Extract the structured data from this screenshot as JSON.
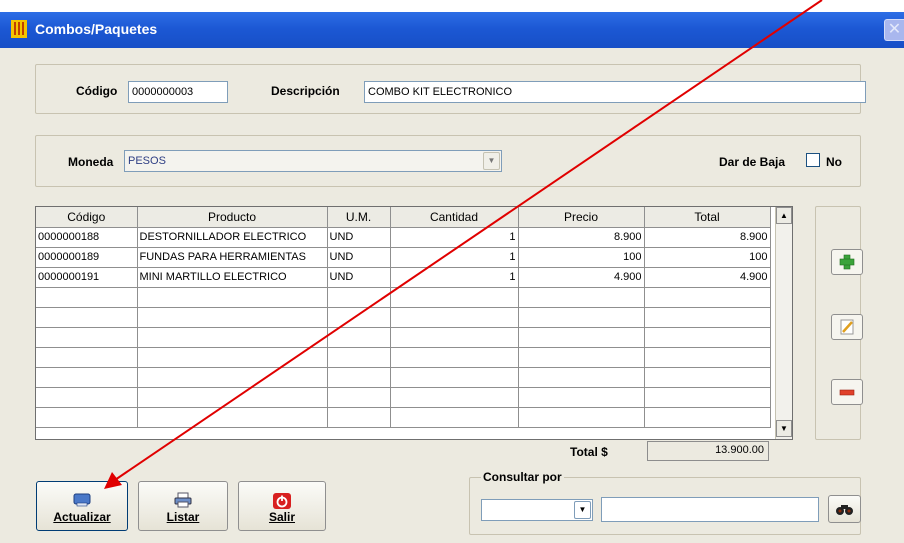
{
  "window": {
    "title": "Combos/Paquetes",
    "close_glyph": "✕"
  },
  "header": {
    "codigo_label": "Código",
    "codigo_value": "0000000003",
    "descripcion_label": "Descripción",
    "descripcion_value": "COMBO KIT ELECTRONICO"
  },
  "moneda": {
    "label": "Moneda",
    "selected": "PESOS",
    "dar_baja_label": "Dar de Baja",
    "dar_baja_value": "No"
  },
  "grid": {
    "columns": [
      "Código",
      "Producto",
      "U.M.",
      "Cantidad",
      "Precio",
      "Total"
    ],
    "rows": [
      [
        "0000000188",
        "DESTORNILLADOR ELECTRICO",
        "UND",
        "1",
        "8.900",
        "8.900"
      ],
      [
        "0000000189",
        "FUNDAS PARA HERRAMIENTAS",
        "UND",
        "1",
        "100",
        "100"
      ],
      [
        "0000000191",
        "MINI MARTILLO ELECTRICO",
        "UND",
        "1",
        "4.900",
        "4.900"
      ]
    ],
    "empty_rows": 7
  },
  "totals": {
    "label": "Total $",
    "value": "13.900.00"
  },
  "buttons": {
    "actualizar": "Actualizar",
    "listar": "Listar",
    "salir": "Salir"
  },
  "consultar": {
    "title": "Consultar por",
    "selected": "",
    "query": ""
  },
  "icons": {
    "app": "app-icon",
    "add": "plus-icon",
    "edit": "pencil-icon",
    "remove": "minus-icon",
    "actualizar": "save-disk-icon",
    "listar": "printer-icon",
    "salir": "power-icon",
    "search": "binoculars-icon"
  },
  "colors": {
    "titlebar": "#1c58d4",
    "client": "#eceae0",
    "annotation_arrow": "#e00000"
  }
}
